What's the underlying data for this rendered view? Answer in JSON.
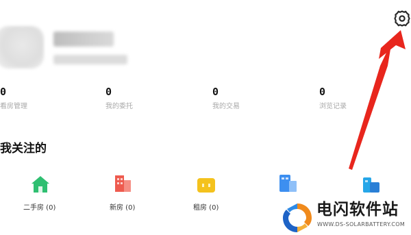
{
  "settings": {
    "icon": "gear-icon"
  },
  "stats": [
    {
      "value": "0",
      "label": "看房管理"
    },
    {
      "value": "0",
      "label": "我的委托"
    },
    {
      "value": "0",
      "label": "我的交易"
    },
    {
      "value": "0",
      "label": "浏览记录"
    }
  ],
  "follows": {
    "title": "我关注的",
    "items": [
      {
        "label": "二手房 (0)",
        "icon": "house-icon",
        "color": "#2fbf71"
      },
      {
        "label": "新房 (0)",
        "icon": "building-icon",
        "color": "#ee5b4f"
      },
      {
        "label": "租房 (0)",
        "icon": "rent-icon",
        "color": "#f4c21d"
      },
      {
        "label": "",
        "icon": "apartment-icon",
        "color": "#3d8ff0"
      },
      {
        "label": "",
        "icon": "shop-icon",
        "color": "#26a6e8"
      }
    ]
  },
  "watermark": {
    "title": "电闪软件站",
    "url": "WWW.DS-SOLARBATTERY.COM"
  },
  "colors": {
    "annotation": "#e8261d"
  }
}
